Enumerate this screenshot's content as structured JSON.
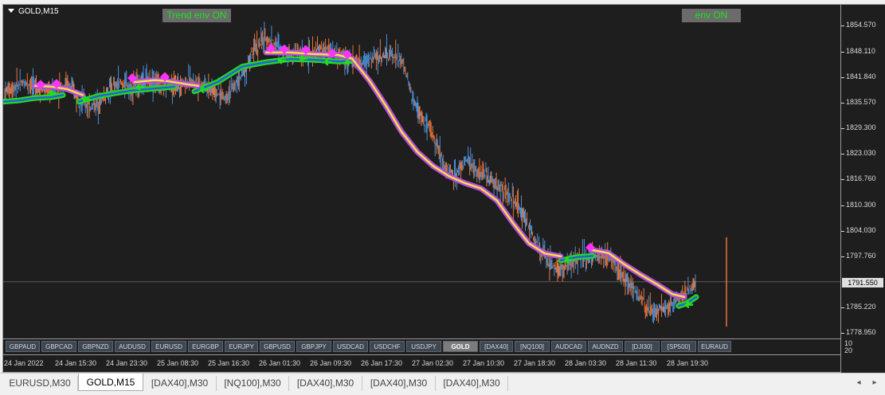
{
  "chart": {
    "title": "GOLD,M15",
    "trend_label": "Trend env ON",
    "env_label": "env ON",
    "current_price": "1791.550",
    "price_ticks": [
      "1854.570",
      "1848.110",
      "1841.840",
      "1835.570",
      "1829.300",
      "1823.030",
      "1816.760",
      "1810.300",
      "1804.030",
      "1797.760",
      "1791.550",
      "1785.220",
      "1778.950"
    ],
    "volume_labels": [
      "10",
      "20"
    ],
    "time_ticks": [
      "24 Jan 2022",
      "24 Jan 15:30",
      "24 Jan 23:30",
      "25 Jan 08:30",
      "25 Jan 16:30",
      "26 Jan 01:30",
      "26 Jan 09:30",
      "26 Jan 17:30",
      "27 Jan 02:30",
      "27 Jan 10:30",
      "27 Jan 18:30",
      "28 Jan 03:30",
      "28 Jan 11:30",
      "28 Jan 19:30"
    ],
    "colors": {
      "background": "#1e1e1e",
      "bull_bar": "#4a8fd8",
      "bear_bar": "#e8743a",
      "up_band_outer": "#22d822",
      "up_band_inner": "#2a5fd8",
      "down_band_outer": "#b84be0",
      "down_band_inner": "#f0e040",
      "signal_marker": "#ff33ff",
      "signal_arrow": "#22dd22"
    }
  },
  "symbols": [
    {
      "label": "GBPAUD",
      "active": false
    },
    {
      "label": "GBPCAD",
      "active": false
    },
    {
      "label": "GBPNZD",
      "active": false
    },
    {
      "label": "AUDUSD",
      "active": false
    },
    {
      "label": "EURUSD",
      "active": false
    },
    {
      "label": "EURGBP",
      "active": false
    },
    {
      "label": "EURJPY",
      "active": false
    },
    {
      "label": "GBPUSD",
      "active": false
    },
    {
      "label": "GBPJPY",
      "active": false
    },
    {
      "label": "USDCAD",
      "active": false
    },
    {
      "label": "USDCHF",
      "active": false
    },
    {
      "label": "USDJPY",
      "active": false
    },
    {
      "label": "GOLD",
      "active": true
    },
    {
      "label": "[DAX40]",
      "active": false
    },
    {
      "label": "[NQ100]",
      "active": false
    },
    {
      "label": "AUDCAD",
      "active": false
    },
    {
      "label": "AUDNZD",
      "active": false
    },
    {
      "label": "[DJI30]",
      "active": false
    },
    {
      "label": "[SP500]",
      "active": false
    },
    {
      "label": "EURAUD",
      "active": false
    }
  ],
  "tabs": [
    {
      "label": "EURUSD,M30",
      "active": false
    },
    {
      "label": "GOLD,M15",
      "active": true
    },
    {
      "label": "[DAX40],M30",
      "active": false
    },
    {
      "label": "[NQ100],M30",
      "active": false
    },
    {
      "label": "[DAX40],M30",
      "active": false
    },
    {
      "label": "[DAX40],M30",
      "active": false
    },
    {
      "label": "[DAX40],M30",
      "active": false
    }
  ],
  "scroll": {
    "left_icon": "chevron-left-icon",
    "right_icon": "chevron-right-icon",
    "left_glyph": "◂",
    "right_glyph": "▸"
  },
  "chart_data": {
    "type": "candlestick",
    "title": "GOLD,M15",
    "ylim": [
      1778.95,
      1857.0
    ],
    "series": [
      {
        "approx_close": [
          1838.5,
          1839.6,
          1840.8,
          1839.5,
          1838.2,
          1839.0,
          1840.5,
          1837.0,
          1834.5,
          1836.0,
          1838.5,
          1840.5,
          1839.5,
          1840.5,
          1841.0,
          1840.0,
          1839.5,
          1840.5,
          1841.2,
          1840.0,
          1838.5,
          1837.0,
          1840.0,
          1844.0,
          1849.5,
          1851.5,
          1849.8,
          1847.8,
          1848.3,
          1847.0,
          1848.8,
          1848.4,
          1847.2,
          1846.0,
          1845.5,
          1846.5,
          1847.2,
          1847.6,
          1845.5,
          1836.0,
          1831.0,
          1827.0,
          1820.0,
          1818.0,
          1821.5,
          1819.0,
          1817.5,
          1815.5,
          1813.0,
          1810.0,
          1805.0,
          1800.0,
          1796.0,
          1794.5,
          1796.0,
          1797.5,
          1797.8,
          1798.0,
          1797.0,
          1793.0,
          1790.0,
          1786.0,
          1784.0,
          1785.5,
          1787.0,
          1789.0,
          1791.5
        ]
      }
    ]
  }
}
